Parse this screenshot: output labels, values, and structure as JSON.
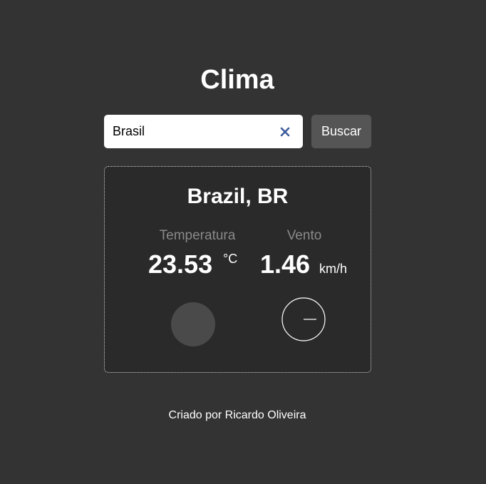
{
  "header": {
    "title": "Clima"
  },
  "search": {
    "value": "Brasil",
    "button_label": "Buscar",
    "clear_icon": "close-icon"
  },
  "weather": {
    "location": "Brazil, BR",
    "temperature": {
      "label": "Temperatura",
      "value": "23.53",
      "unit": "°C"
    },
    "wind": {
      "label": "Vento",
      "value": "1.46",
      "unit": "km/h"
    },
    "icons": {
      "condition": "weather-condition-icon",
      "wind_direction": "wind-direction-icon"
    }
  },
  "footer": {
    "credit": "Criado por Ricardo Oliveira"
  },
  "colors": {
    "background": "#333333",
    "card_background": "#2a2a2a",
    "button_background": "#555555",
    "muted_label": "#8a8a8a",
    "clear_icon": "#3b5b9a"
  }
}
